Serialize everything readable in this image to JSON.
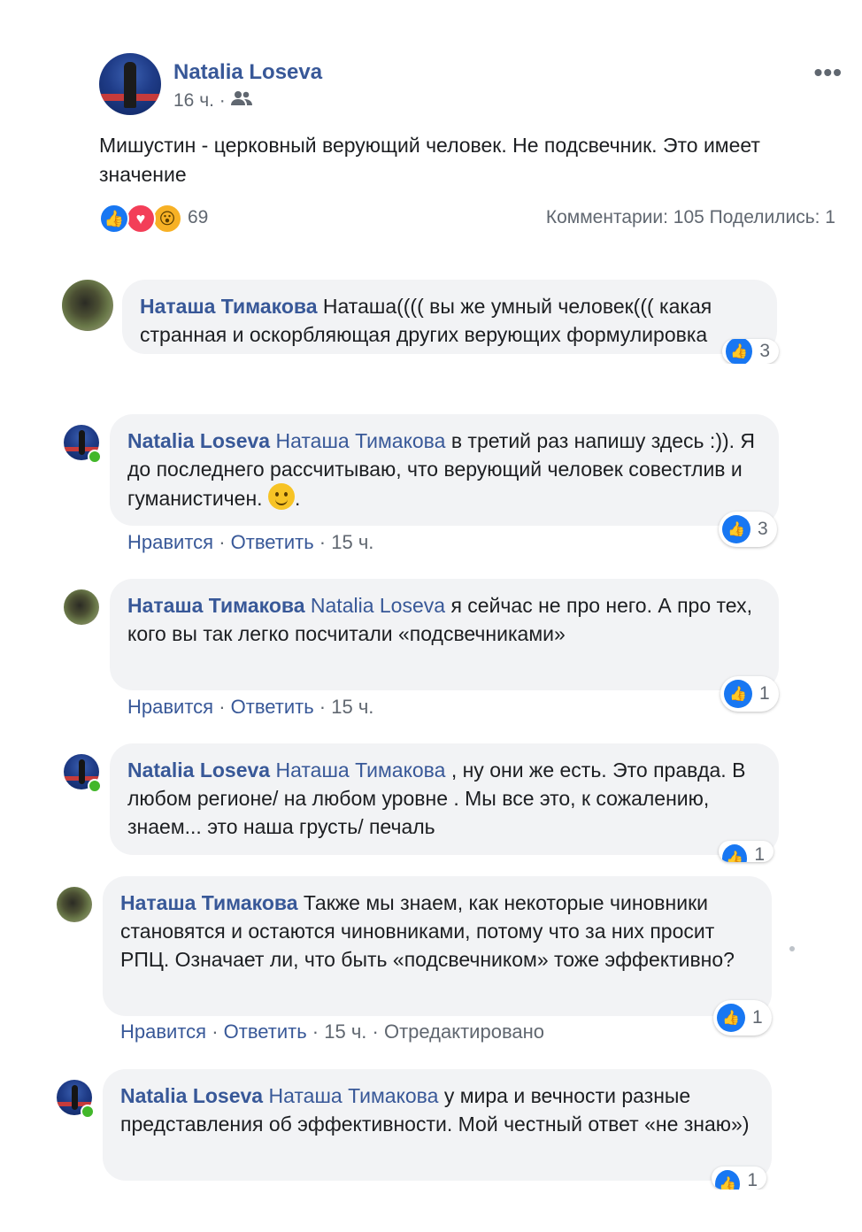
{
  "post": {
    "author": "Natalia Loseva",
    "time": "16 ч. ·",
    "audience_icon": "friends-icon",
    "more_label": "•••",
    "text": "Мишустин - церковный верующий человек. Не подсвечник. Это имеет значение",
    "reactions": {
      "icons": [
        "like-icon",
        "love-icon",
        "wow-icon"
      ],
      "count": "69"
    },
    "stats": "Комментарии: 105  Поделились: 1"
  },
  "comments": [
    {
      "author": "Наташа Тимакова",
      "mention": "",
      "text": "Наташа(((( вы же умный человек((( какая странная и оскорбляющая других верующих формулировка",
      "likes": "3"
    },
    {
      "author": "Natalia Loseva",
      "mention": "Наташа Тимакова",
      "text": "в третий раз напишу здесь :)). Я до последнего рассчитываю, что верующий человек совестлив и гуманистичен.",
      "text_end": ".",
      "likes": "3",
      "like_label": "Нравится",
      "reply_label": "Ответить",
      "time": "15 ч."
    },
    {
      "author": "Наташа Тимакова",
      "mention": "Natalia Loseva",
      "text": "я сейчас не про него. А про тех, кого вы так легко посчитали «подсвечниками»",
      "likes": "1",
      "like_label": "Нравится",
      "reply_label": "Ответить",
      "time": "15 ч."
    },
    {
      "author": "Natalia Loseva",
      "mention": "Наташа Тимакова",
      "text": ", ну они же есть. Это правда. В любом регионе/ на любом уровне . Мы все это, к сожалению, знаем... это наша грусть/ печаль",
      "likes": "1"
    },
    {
      "author": "Наташа Тимакова",
      "mention": "",
      "text": "Также мы знаем, как некоторые чиновники становятся и остаются чиновниками, потому что за них просит РПЦ. Означает ли, что быть «подсвечником» тоже эффективно?",
      "likes": "1",
      "like_label": "Нравится",
      "reply_label": "Ответить",
      "time": "15 ч.",
      "edited": "Отредактировано"
    },
    {
      "author": "Natalia Loseva",
      "mention": "Наташа Тимакова",
      "text": "у мира и вечности разные представления об эффективности. Мой честный ответ «не знаю»)",
      "likes": "1"
    }
  ],
  "colors": {
    "link": "#385898",
    "muted": "#606770",
    "bubble": "#f2f3f5",
    "like": "#1877f2",
    "online": "#42b72a"
  }
}
